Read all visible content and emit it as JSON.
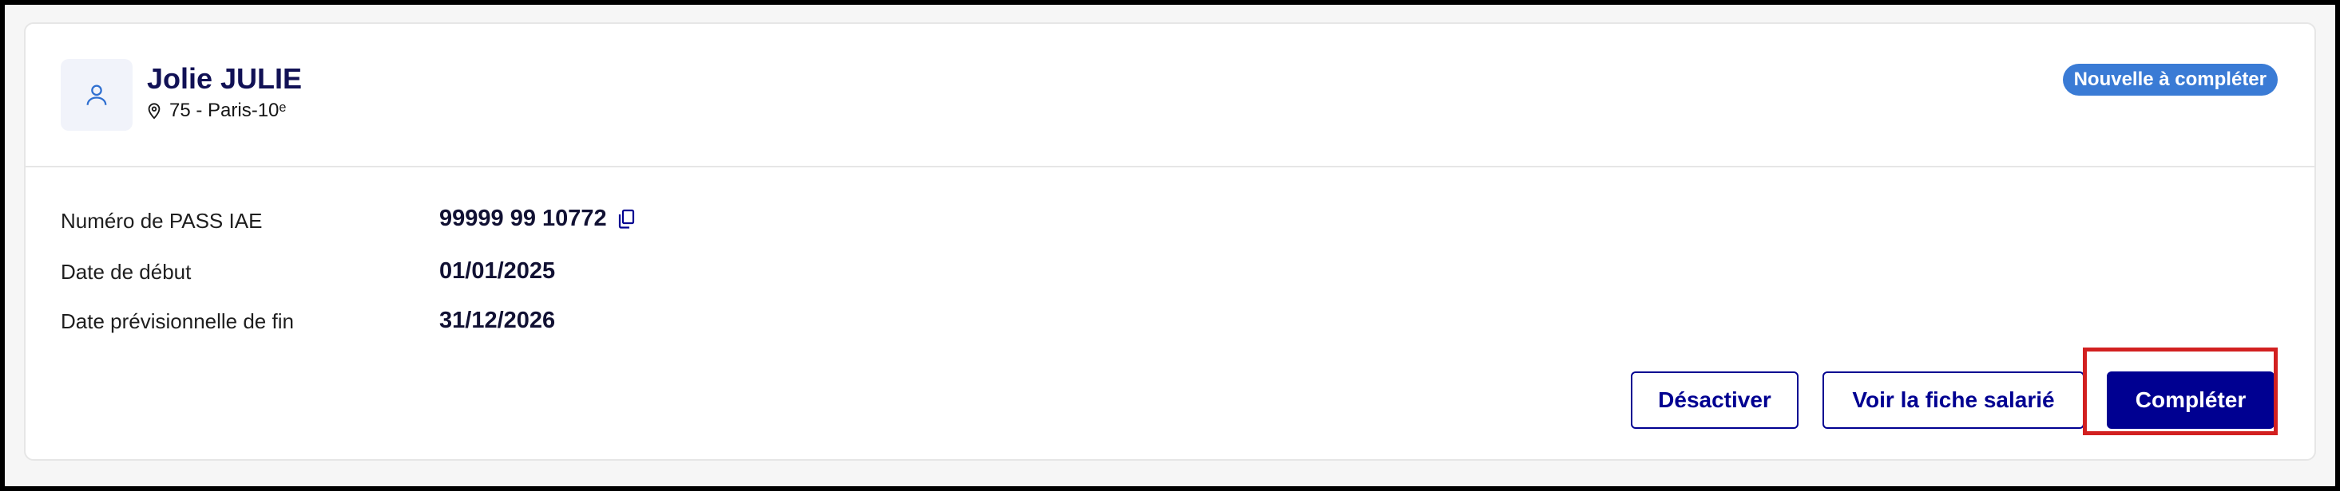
{
  "card": {
    "person": {
      "name": "Jolie JULIE",
      "location": "75 - Paris-10ᵉ",
      "avatar_icon": "user-icon",
      "location_icon": "map-pin-icon"
    },
    "status_badge": "Nouvelle à compléter",
    "fields": [
      {
        "label": "Numéro de PASS IAE",
        "value": "99999 99 10772"
      },
      {
        "label": "Date de début",
        "value": "01/01/2025"
      },
      {
        "label": "Date prévisionnelle de fin",
        "value": "31/12/2026"
      }
    ],
    "actions": {
      "deactivate_label": "Désactiver",
      "view_label": "Voir la fiche salarié",
      "complete_label": "Compléter"
    }
  },
  "colors": {
    "primary": "#000091",
    "badge": "#3a7bd5",
    "highlight": "#d22020"
  }
}
